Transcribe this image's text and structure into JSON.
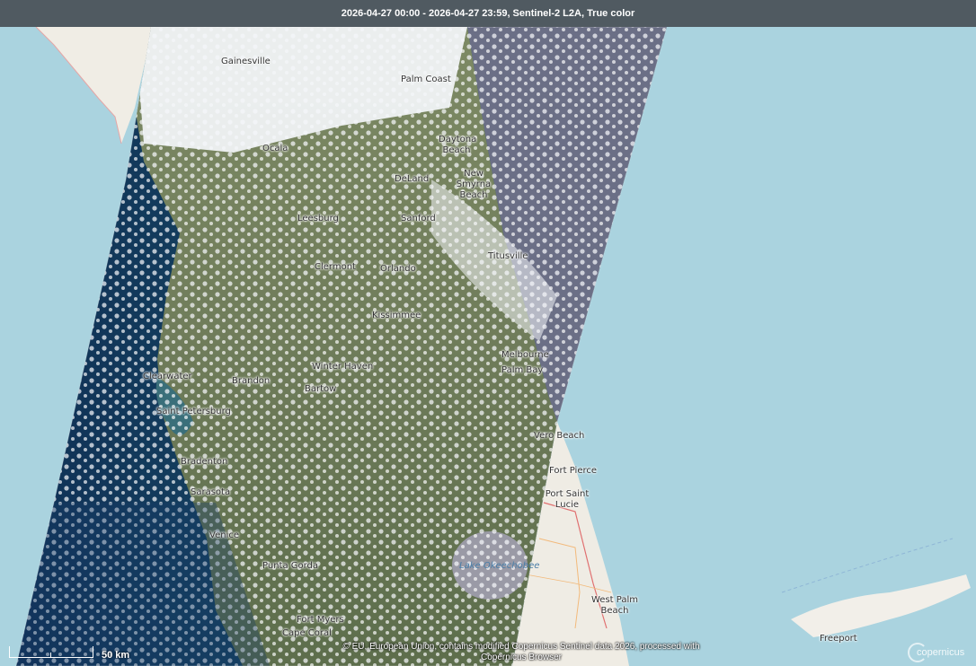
{
  "header": {
    "title": "2026-04-27 00:00 - 2026-04-27 23:59, Sentinel-2 L2A, True color"
  },
  "places": [
    {
      "name": "Gainesville"
    },
    {
      "name": "Palm Coast"
    },
    {
      "name": "Ocala"
    },
    {
      "name": "Daytona\nBeach"
    },
    {
      "name": "New Smyrna\nBeach"
    },
    {
      "name": "DeLand"
    },
    {
      "name": "Leesburg"
    },
    {
      "name": "Sanford"
    },
    {
      "name": "Titusville"
    },
    {
      "name": "Clermont"
    },
    {
      "name": "Orlando"
    },
    {
      "name": "Kissimmee"
    },
    {
      "name": "Melbourne"
    },
    {
      "name": "Palm Bay"
    },
    {
      "name": "Winter Haven"
    },
    {
      "name": "Clearwater"
    },
    {
      "name": "Brandon"
    },
    {
      "name": "Bartow"
    },
    {
      "name": "Saint Petersburg"
    },
    {
      "name": "Vero Beach"
    },
    {
      "name": "Bradenton"
    },
    {
      "name": "Fort Pierce"
    },
    {
      "name": "Sarasota"
    },
    {
      "name": "Port Saint\nLucie"
    },
    {
      "name": "Venice"
    },
    {
      "name": "Lake Okeechobee"
    },
    {
      "name": "Punta Gorda"
    },
    {
      "name": "West Palm\nBeach"
    },
    {
      "name": "Fort Myers"
    },
    {
      "name": "Cape Coral"
    },
    {
      "name": "Freeport"
    }
  ],
  "scale": {
    "label": "50 km"
  },
  "attribution": {
    "text": "© EU, European Union, contains modified Copernicus Sentinel data 2026, processed with Copernicus Browser"
  },
  "logo": {
    "text": "copernicus"
  },
  "colors": {
    "sea": "#aad3df",
    "land": "#f2efe9",
    "imagery_land": "#6e7a5a",
    "imagery_sea": "#1f4f6a",
    "clouds": "#f4f6fa"
  }
}
